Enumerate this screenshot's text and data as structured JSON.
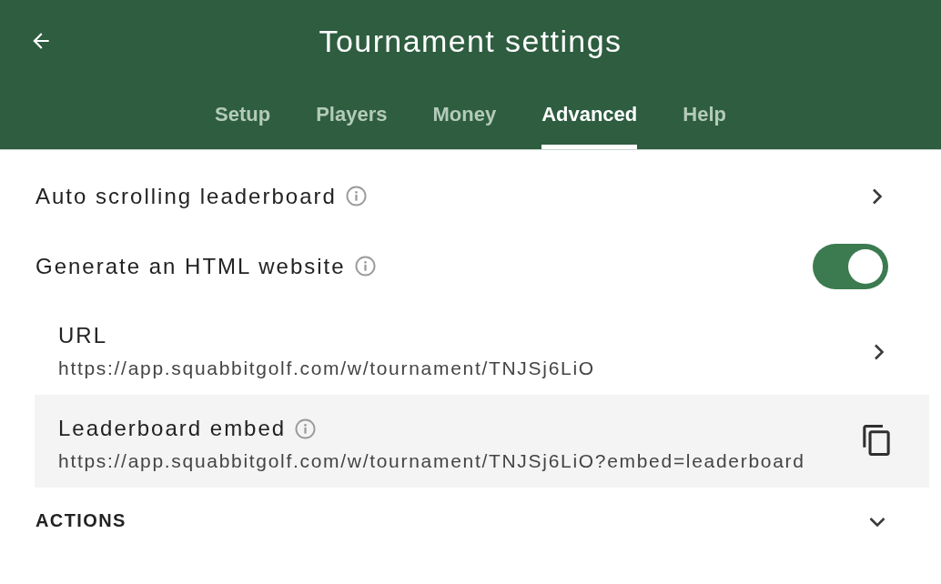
{
  "header": {
    "title": "Tournament settings"
  },
  "tabs": [
    {
      "label": "Setup",
      "selected": false
    },
    {
      "label": "Players",
      "selected": false
    },
    {
      "label": "Money",
      "selected": false
    },
    {
      "label": "Advanced",
      "selected": true
    },
    {
      "label": "Help",
      "selected": false
    }
  ],
  "settings": [
    {
      "kind": "link",
      "label": "Auto scrolling leaderboard",
      "info": true
    },
    {
      "kind": "toggle",
      "label": "Generate an HTML website",
      "info": true,
      "on": true
    }
  ],
  "website": [
    {
      "kind": "link",
      "label": "URL",
      "info": false,
      "value": "https://app.squabbitgolf.com/w/tournament/TNJSj6LiO",
      "highlighted": false
    },
    {
      "kind": "copy",
      "label": "Leaderboard embed",
      "info": true,
      "value": "https://app.squabbitgolf.com/w/tournament/TNJSj6LiO?embed=leaderboard",
      "highlighted": true
    }
  ],
  "sections": [
    {
      "label": "ACTIONS",
      "expanded": false
    }
  ]
}
